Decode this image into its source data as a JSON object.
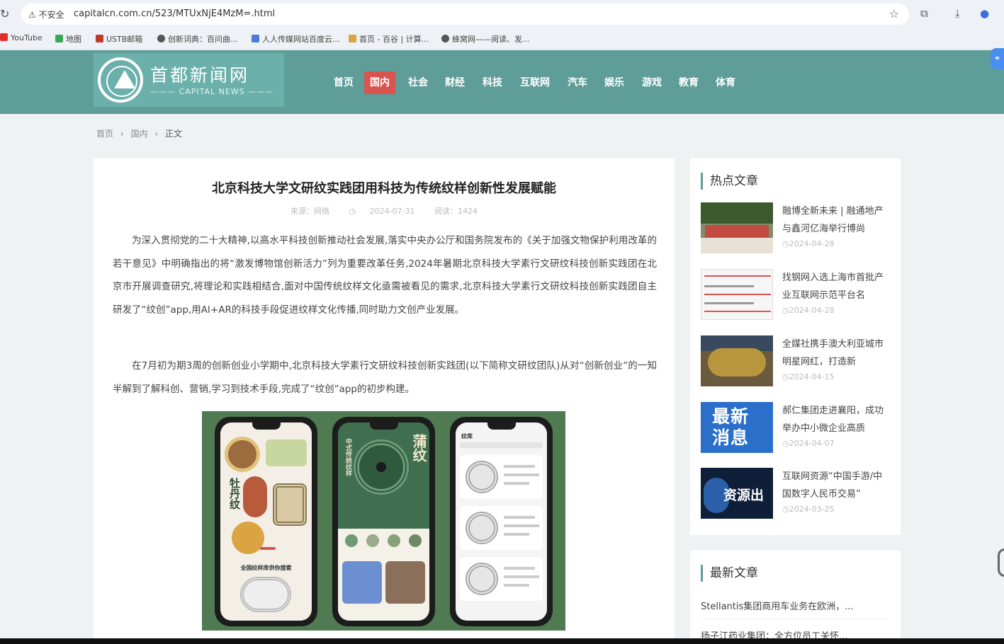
{
  "browser": {
    "security": "不安全",
    "url": "capitalcn.com.cn/523/MTUxNjE4MzM=.html",
    "bookmarks": [
      "YouTube",
      "地图",
      "USTB邮箱",
      "创新词典：百问曲...",
      "人人传媒网站百度云...",
      "首页 - 百谷 | 计算...",
      "蜂窝网——阅读、发..."
    ]
  },
  "site": {
    "logo_title": "首都新闻网",
    "logo_sub": "——— CAPITAL NEWS ———",
    "nav": [
      "首页",
      "国内",
      "社会",
      "财经",
      "科技",
      "互联网",
      "汽车",
      "娱乐",
      "游戏",
      "教育",
      "体育"
    ],
    "nav_active": "国内"
  },
  "breadcrumb": [
    "首页",
    "›",
    "国内",
    "›",
    "正文"
  ],
  "article": {
    "title": "北京科技大学文研纹实践团用科技为传统纹样创新性发展赋能",
    "source": "来源：网络",
    "date": "2024-07-31",
    "views": "阅读：1424",
    "para1": "为深入贯彻党的二十大精神,以高水平科技创新推动社会发展,落实中央办公厅和国务院发布的《关于加强文物保护利用改革的若干意见》中明确指出的将“激发博物馆创新活力”列为重要改革任务,2024年暑期北京科技大学素行文研纹科技创新实践团在北京市开展调查研究,将理论和实践相结合,面对中国传统纹样文化亟需被看见的需求,北京科技大学素行文研纹科技创新实践团自主研发了“纹创”app,用AI+AR的科技手段促进纹样文化传播,同时助力文创产业发展。",
    "para2": "在7月初为期3周的创新创业小学期中,北京科技大学素行文研纹科技创新实践团(以下简称文研纹团队)从对“创新创业”的一知半解到了解科创、营销,学习到技术手段,完成了“纹创”app的初步构建。",
    "image_text": {
      "phone1_label": "牡丹纹",
      "phone1_bottom": "全国纹样库供你搜索",
      "phone2_label": "蒲纹",
      "phone2_sub": "中式传统纹样",
      "phone3_header": "纹库"
    }
  },
  "sidebar": {
    "hot_title": "热点文章",
    "hot_items": [
      {
        "title": "融博全新未来 | 融通地产与鑫河亿海举行博尚",
        "date": "2024-04-28"
      },
      {
        "title": "找钢网入选上海市首批产业互联网示范平台名",
        "date": "2024-04-28"
      },
      {
        "title": "全媒社携手澳大利亚城市明星网红，打造新",
        "date": "2024-04-15"
      },
      {
        "title": "郝仁集团走进襄阳，成功举办中小微企业高质",
        "date": "2024-04-07"
      },
      {
        "title": "互联网资源“中国手游/中国数字人民币交易”",
        "date": "2024-03-25"
      }
    ],
    "thumb4_text": "最新消息",
    "thumb5_text": "资源出",
    "latest_title": "最新文章",
    "latest_items": [
      "Stellantis集团商用车业务在欧洲，...",
      "扬子江药业集团：全方位员工关怀..."
    ]
  },
  "colors": {
    "header": "#5f9d99",
    "nav_active": "#d9534f",
    "accent": "#5f9d99"
  }
}
